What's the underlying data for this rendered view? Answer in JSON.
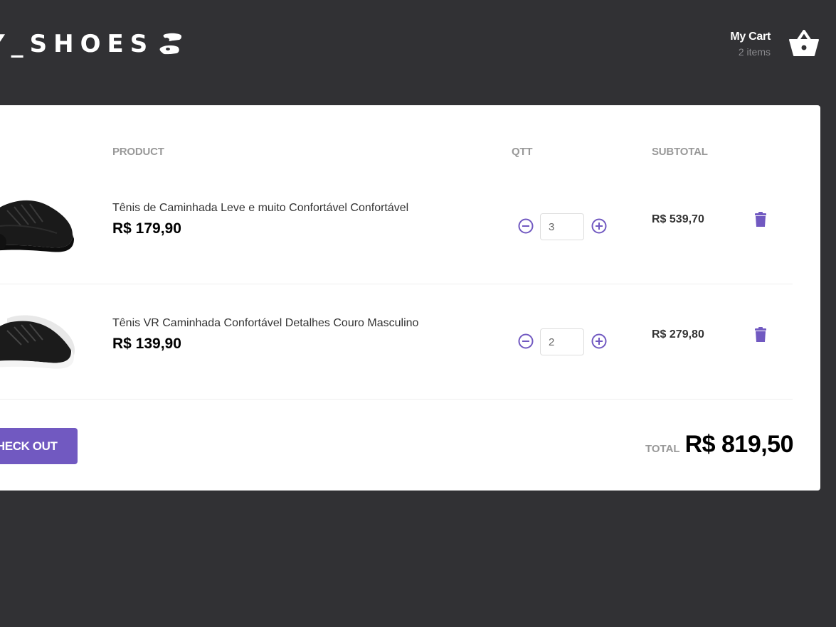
{
  "header": {
    "logo_text": "Y_SHOES",
    "logo_icon": "footprints-icon",
    "cart_title": "My Cart",
    "cart_count": "2 items",
    "cart_icon": "basket-icon"
  },
  "table": {
    "columns": [
      "PRODUCT",
      "QTT",
      "SUBTOTAL"
    ],
    "rows": [
      {
        "name": "Tênis de Caminhada Leve e muito Confortável Confortável",
        "price": "R$ 179,90",
        "quantity": "3",
        "subtotal": "R$ 539,70",
        "image": "black-sneaker-image"
      },
      {
        "name": "Tênis VR Caminhada Confortável Detalhes Couro Masculino",
        "price": "R$ 139,90",
        "quantity": "2",
        "subtotal": "R$ 279,80",
        "image": "black-white-sneaker-image"
      }
    ]
  },
  "footer": {
    "checkout_label": "CHECK OUT",
    "total_label": "TOTAL",
    "total_value": "R$ 819,50"
  },
  "colors": {
    "background": "#313134",
    "accent": "#7159c1",
    "card": "#ffffff"
  }
}
